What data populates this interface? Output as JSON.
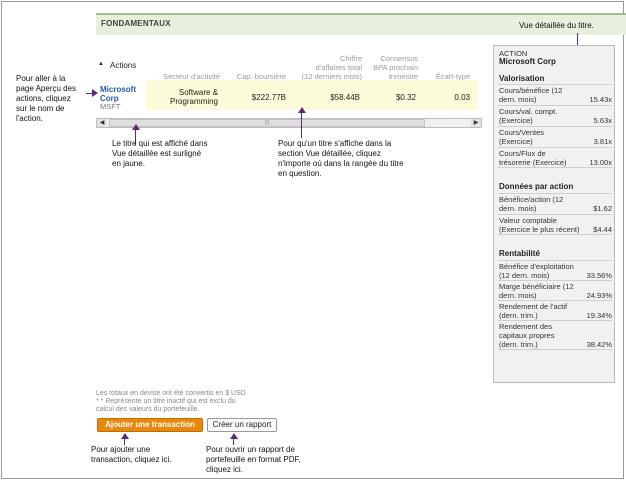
{
  "header": {
    "title": "FONDAMENTAUX"
  },
  "annotations": {
    "detail_view": "Vue détaillée du titre.",
    "stock_link": [
      "Pour aller à la",
      "page Aperçu des",
      "actions,  cliquez",
      "sur le nom de",
      "l'action."
    ],
    "highlight": [
      "Le titre qui est affiché dans",
      "Vue détaillée est surligné",
      "en jaune."
    ],
    "select_row": [
      "Pour qu'un titre s'affiche dans la",
      "section Vue détaillée, cliquez",
      "n'importe où dans la rangée du titre",
      "en question."
    ],
    "add_txn": [
      "Pour ajouter une",
      "transaction, cliquez ici."
    ],
    "pdf_report": [
      "Pour ouvrir un rapport de",
      "portefeuille en format PDF,",
      "cliquez ici."
    ]
  },
  "table": {
    "actions_label": "Actions",
    "columns": {
      "sector": "Secteur d'activité",
      "market_cap": "Cap. boursière",
      "revenue": [
        "Chiffre",
        "d'affaires total",
        "(12 derniers mois)"
      ],
      "eps": [
        "Consensus",
        "BPA prochain",
        "trimestre"
      ],
      "stddev": "Écart-type"
    },
    "row": {
      "name": [
        "Microsoft",
        "Corp"
      ],
      "ticker": "MSFT",
      "sector": [
        "Software &",
        "Programming"
      ],
      "market_cap": "$222.77B",
      "revenue": "$58.44B",
      "eps": "$0.32",
      "stddev": "0.03"
    }
  },
  "detail": {
    "type_label": "ACTION",
    "company": "Microsoft Corp",
    "valuation": {
      "title": "Valorisation",
      "rows": [
        {
          "label": [
            "Cours/bénéfice (12",
            "dern. mois)"
          ],
          "value": "15.43x"
        },
        {
          "label": [
            "Cours/val. compt.",
            "(Exercice)"
          ],
          "value": "5.63x"
        },
        {
          "label": [
            "Cours/Ventes",
            "(Exercice)"
          ],
          "value": "3.81x"
        },
        {
          "label": [
            "Cours/Flux de",
            "trésorerie (Exercice)"
          ],
          "value": "13.00x"
        }
      ]
    },
    "per_share": {
      "title": "Données par action",
      "rows": [
        {
          "label": [
            "Bénéfice/action (12",
            "dern. mois)"
          ],
          "value": "$1.62"
        },
        {
          "label": [
            "Valeur comptable",
            "(Exercice le plus récent)"
          ],
          "value": "$4.44"
        }
      ]
    },
    "profitability": {
      "title": "Rentabilité",
      "rows": [
        {
          "label": [
            "Bénéfice d'exploitation",
            "(12 dern. mois)"
          ],
          "value": "33.56%"
        },
        {
          "label": [
            "Marge bénéficiaire (12",
            "dern. mois)"
          ],
          "value": "24.93%"
        },
        {
          "label": [
            "Rendement de l'actif",
            "(dern. trim.)"
          ],
          "value": "19.34%"
        },
        {
          "label": [
            "Rendement des",
            "capitaux propres",
            "(dern. trim.)"
          ],
          "value": "38.42%"
        }
      ]
    }
  },
  "footer": {
    "note1": "Les totaux en devise ont été convertis en $ USD",
    "note2": [
      "* * Représente un titre inactif qui est exclu du",
      "calcul des valeurs du portefeuille."
    ],
    "add_transaction": "Ajouter une transaction",
    "create_report": "Créer un rapport"
  },
  "colors": {
    "accent_orange": "#e8890c",
    "link_blue": "#2a5aa8",
    "highlight_yellow": "#fbfbd9",
    "header_green": "#e6f0dc",
    "arrow_purple": "#5b2a74"
  }
}
